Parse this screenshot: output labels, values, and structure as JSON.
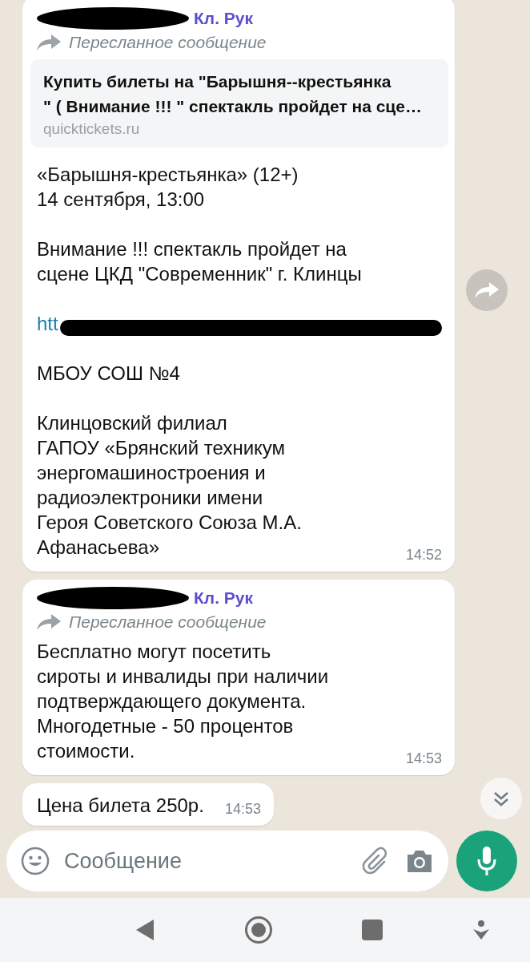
{
  "messages": [
    {
      "sender": "Кл. Рук",
      "forwarded": "Пересланное сообщение",
      "preview": {
        "title": "Купить билеты на \"Барышня--крестьянка\n\" ( Внимание !!! \" спектакль пройдет на сце…",
        "domain": "quicktickets.ru"
      },
      "body": [
        {
          "kind": "text",
          "text": "«Барышня-крестьянка» (12+)\n14 сентября, 13:00"
        },
        {
          "kind": "text",
          "text": "Внимание !!! спектакль пройдет на\nсцене ЦКД \"Современник\" г. Клинцы"
        },
        {
          "kind": "link",
          "text": "htt"
        },
        {
          "kind": "text",
          "text": "МБОУ СОШ №4"
        },
        {
          "kind": "text",
          "text": "Клинцовский филиал\nГАПОУ «Брянский техникум\nэнергомашиностроения и\nрадиоэлектроники имени\nГероя Советского Союза М.А.\nАфанасьева»"
        }
      ],
      "time": "14:52"
    },
    {
      "sender": "Кл. Рук",
      "forwarded": "Пересланное сообщение",
      "body": [
        {
          "kind": "text",
          "text": "Бесплатно могут посетить\nсироты и инвалиды при наличии\nподтверждающего документа.\nМногодетные - 50 процентов\nстоимости."
        }
      ],
      "time": "14:53"
    },
    {
      "body": [
        {
          "kind": "text",
          "text": "Цена билета 250р."
        }
      ],
      "time": "14:53"
    }
  ],
  "composer": {
    "placeholder": "Сообщение"
  }
}
